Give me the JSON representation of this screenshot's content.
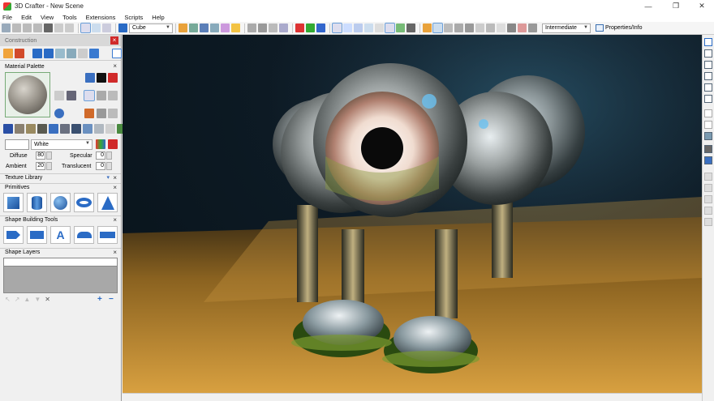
{
  "window": {
    "title": "3D Crafter - New Scene",
    "minimize_glyph": "—",
    "restore_glyph": "❐",
    "close_glyph": "✕"
  },
  "menu": [
    "File",
    "Edit",
    "View",
    "Tools",
    "Extensions",
    "Scripts",
    "Help"
  ],
  "toolbar": {
    "shape_select_value": "Cube",
    "mode_select_value": "Intermediate",
    "properties_label": "Properties/Info"
  },
  "construction": {
    "title": "Construction",
    "close_glyph": "×"
  },
  "material_palette": {
    "title": "Material Palette",
    "close_glyph": "×",
    "color_name": "White",
    "diffuse_label": "Diffuse",
    "diffuse_value": "80",
    "ambient_label": "Ambient",
    "ambient_value": "20",
    "specular_label": "Specular",
    "specular_value": "0",
    "translucent_label": "Translucent",
    "translucent_value": "0"
  },
  "texture_library": {
    "title": "Texture Library",
    "close_glyph": "×"
  },
  "primitives": {
    "title": "Primitives",
    "close_glyph": "×",
    "items": [
      "cube-icon",
      "cylinder-icon",
      "sphere-icon",
      "torus-icon",
      "cone-icon"
    ]
  },
  "shape_building": {
    "title": "Shape Building Tools",
    "close_glyph": "×"
  },
  "shape_layers": {
    "title": "Shape Layers",
    "close_glyph": "×",
    "add_glyph": "+",
    "remove_glyph": "−"
  },
  "colors": {
    "accent_blue": "#2a6bc5",
    "toolbar_bg": "#f5f5f5",
    "panel_bg": "#f0f0f0",
    "scene_floor": "#c08a30",
    "red_close": "#d02a2a"
  }
}
